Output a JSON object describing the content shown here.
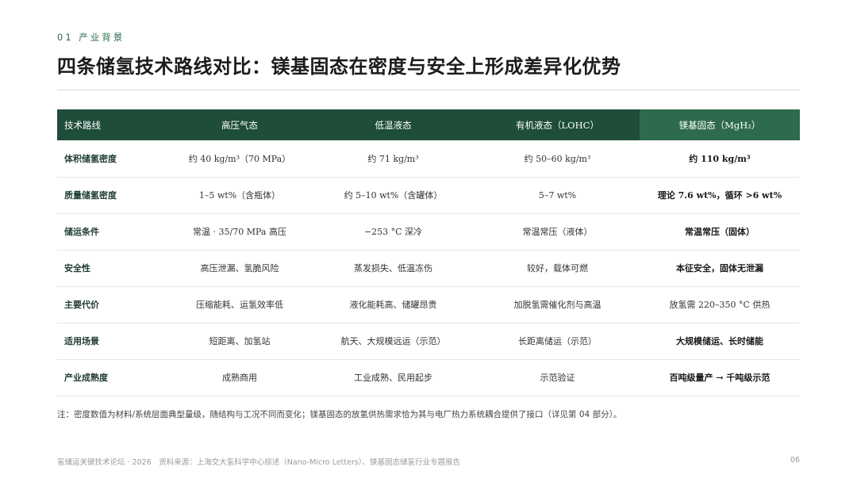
{
  "section_label": "01 产业背景",
  "title": "四条储氢技术路线对比：镁基固态在密度与安全上形成差异化优势",
  "table": {
    "headers": [
      "技术路线",
      "高压气态",
      "低温液态",
      "有机液态（LOHC）",
      "镁基固态（MgH₂）"
    ],
    "rows": [
      [
        "体积储氢密度",
        "约 40 kg/m³（70 MPa）",
        "约 71 kg/m³",
        "约 50–60 kg/m³",
        "约 110 kg/m³"
      ],
      [
        "质量储氢密度",
        "1–5 wt%（含瓶体）",
        "约 5–10 wt%（含罐体）",
        "5–7 wt%",
        "理论 7.6 wt%，循环 >6 wt%"
      ],
      [
        "储运条件",
        "常温 · 35/70 MPa 高压",
        "−253 °C 深冷",
        "常温常压（液体）",
        "常温常压（固体）"
      ],
      [
        "安全性",
        "高压泄漏、氢脆风险",
        "蒸发损失、低温冻伤",
        "较好，载体可燃",
        "本征安全，固体无泄漏"
      ],
      [
        "主要代价",
        "压缩能耗、运氢效率低",
        "液化能耗高、储罐昂贵",
        "加脱氢需催化剂与高温",
        "放氢需 220–350 °C 供热"
      ],
      [
        "适用场景",
        "短距离、加氢站",
        "航天、大规模远运（示范）",
        "长距离储运（示范）",
        "大规模储运、长时储能"
      ],
      [
        "产业成熟度",
        "成熟商用",
        "工业成熟、民用起步",
        "示范验证",
        "百吨级量产 → 千吨级示范"
      ]
    ]
  },
  "note": "注：密度数值为材料/系统层面典型量级，随结构与工况不同而变化；镁基固态的放氢供热需求恰为其与电厂热力系统耦合提供了接口（详见第 04 部分）。",
  "footer": {
    "left": "氢储运关键技术论坛 · 2026　资料来源：上海交大氢科学中心综述（Nano-Micro Letters）、镁基固态储氢行业专题报告",
    "page_number": "06"
  }
}
